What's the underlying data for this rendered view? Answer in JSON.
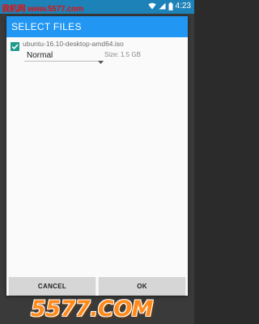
{
  "status_bar": {
    "watermark_text": "我机网 www.5577.com",
    "time": "4:23",
    "icons": [
      "wifi-icon",
      "signal-icon",
      "battery-icon"
    ]
  },
  "dialog": {
    "title": "SELECT FILES",
    "title_bar_color": "#2196f3",
    "file": {
      "checked": true,
      "name": "ubuntu-16.10-desktop-amd64.iso",
      "format": "Normal",
      "size": "Size: 1.5 GB"
    },
    "buttons": {
      "cancel": "CANCEL",
      "ok": "OK"
    }
  },
  "bottom_watermark": "5577.COM",
  "colors": {
    "accent": "#2196f3",
    "checkbox": "#1e9b8b",
    "status_bar": "#1d82b8"
  }
}
